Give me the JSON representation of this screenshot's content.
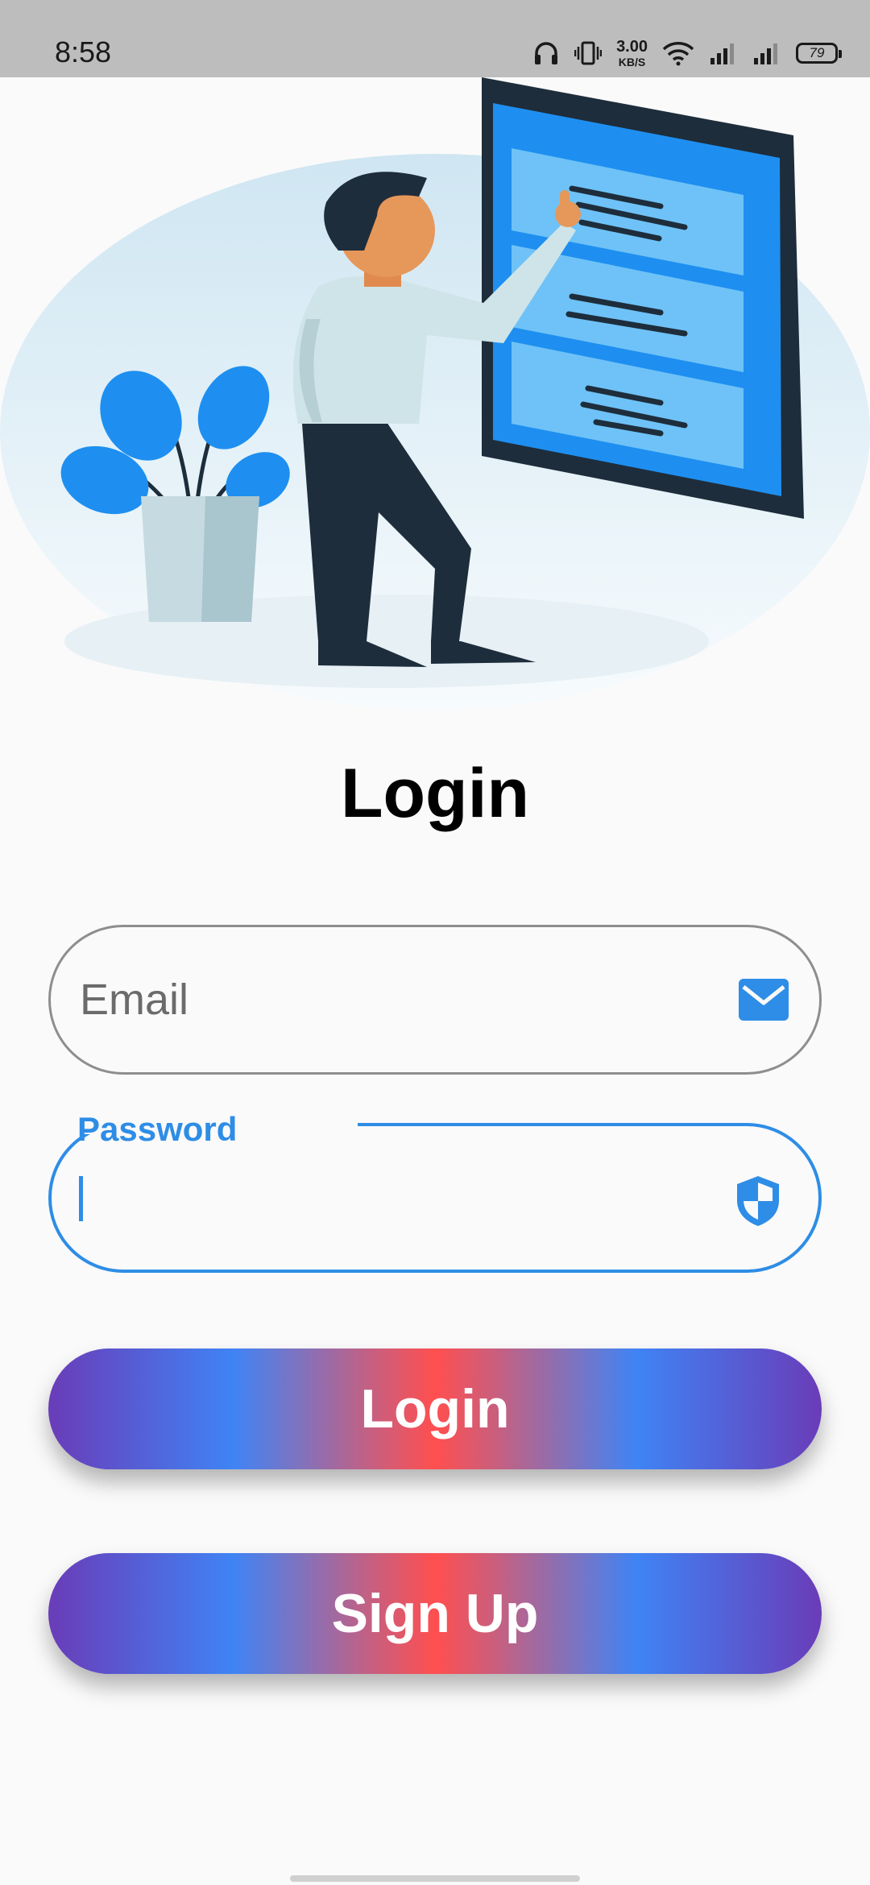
{
  "status_bar": {
    "time": "8:58",
    "network_speed": "3.00",
    "network_speed_unit": "KB/S",
    "battery": "79"
  },
  "login_title": "Login",
  "email_field": {
    "placeholder": "Email",
    "value": ""
  },
  "password_field": {
    "label": "Password",
    "value": ""
  },
  "buttons": {
    "login": "Login",
    "sign_up": "Sign Up"
  },
  "colors": {
    "accent_blue": "#2e8de6",
    "button_gradient": [
      "#6a3cb8",
      "#3f84f5",
      "#ff4f4f"
    ]
  }
}
